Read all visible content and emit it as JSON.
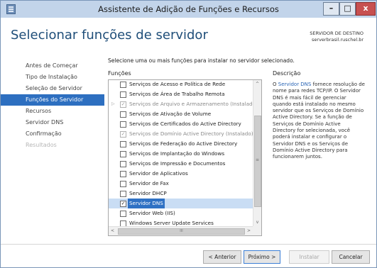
{
  "window": {
    "title": "Assistente de Adição de Funções e Recursos",
    "min": "–",
    "max": "□",
    "close": "x"
  },
  "page_title": "Selecionar funções de servidor",
  "destination": {
    "label": "SERVIDOR DE DESTINO",
    "server": "serverbrasil.ruschel.br"
  },
  "nav": [
    {
      "label": "Antes de Começar",
      "state": "normal"
    },
    {
      "label": "Tipo de Instalação",
      "state": "normal"
    },
    {
      "label": "Seleção de Servidor",
      "state": "normal"
    },
    {
      "label": "Funções do Servidor",
      "state": "active"
    },
    {
      "label": "Recursos",
      "state": "normal"
    },
    {
      "label": "Servidor DNS",
      "state": "normal"
    },
    {
      "label": "Confirmação",
      "state": "normal"
    },
    {
      "label": "Resultados",
      "state": "disabled"
    }
  ],
  "instructions": "Selecione uma ou mais funções para instalar no servidor selecionado.",
  "roles_header": "Funções",
  "description_header": "Descrição",
  "roles": [
    {
      "label": "Serviços de Acesso e Política de Rede",
      "checked": false,
      "grey": false,
      "expander": false,
      "selected": false
    },
    {
      "label": "Serviços de Área de Trabalho Remota",
      "checked": false,
      "grey": false,
      "expander": false,
      "selected": false
    },
    {
      "label": "Serviços de Arquivo e Armazenamento (Instalado)",
      "checked": true,
      "grey": true,
      "expander": true,
      "selected": false
    },
    {
      "label": "Serviços de Ativação de Volume",
      "checked": false,
      "grey": false,
      "expander": false,
      "selected": false
    },
    {
      "label": "Serviços de Certificados do Active Directory",
      "checked": false,
      "grey": false,
      "expander": false,
      "selected": false
    },
    {
      "label": "Serviços de Domínio Active Directory (Instalado)",
      "checked": true,
      "grey": true,
      "expander": false,
      "selected": false
    },
    {
      "label": "Serviços de Federação do Active Directory",
      "checked": false,
      "grey": false,
      "expander": false,
      "selected": false
    },
    {
      "label": "Serviços de Implantação do Windows",
      "checked": false,
      "grey": false,
      "expander": false,
      "selected": false
    },
    {
      "label": "Serviços de Impressão e Documentos",
      "checked": false,
      "grey": false,
      "expander": false,
      "selected": false
    },
    {
      "label": "Servidor de Aplicativos",
      "checked": false,
      "grey": false,
      "expander": false,
      "selected": false
    },
    {
      "label": "Servidor de Fax",
      "checked": false,
      "grey": false,
      "expander": false,
      "selected": false
    },
    {
      "label": "Servidor DHCP",
      "checked": false,
      "grey": false,
      "expander": false,
      "selected": false
    },
    {
      "label": "Servidor DNS",
      "checked": true,
      "grey": false,
      "expander": false,
      "selected": true
    },
    {
      "label": "Servidor Web (IIS)",
      "checked": false,
      "grey": false,
      "expander": false,
      "selected": false
    },
    {
      "label": "Windows Server Update Services",
      "checked": false,
      "grey": false,
      "expander": false,
      "selected": false
    }
  ],
  "scroll": {
    "up": "^",
    "down": "v",
    "left": "<",
    "right": ">",
    "grip": "≡",
    "hgrip": "III"
  },
  "description": {
    "pre": "O ",
    "link": "Servidor DNS",
    "post": " fornece resolução de nome para redes TCP/IP. O Servidor DNS é mais fácil de gerenciar quando está instalado no mesmo servidor que os Serviços de Domínio Active Directory. Se a função de Serviços de Domínio Active Directory for selecionada, você poderá instalar e configurar o Servidor DNS e os Serviços de Domínio Active Directory para funcionarem juntos."
  },
  "buttons": {
    "previous": "< Anterior",
    "next": "Próximo >",
    "install": "Instalar",
    "cancel": "Cancelar"
  },
  "colors": {
    "accent": "#2d6fc0",
    "link": "#2a65b5",
    "title": "#1f4e79",
    "titlebar": "#c2d4ea"
  }
}
